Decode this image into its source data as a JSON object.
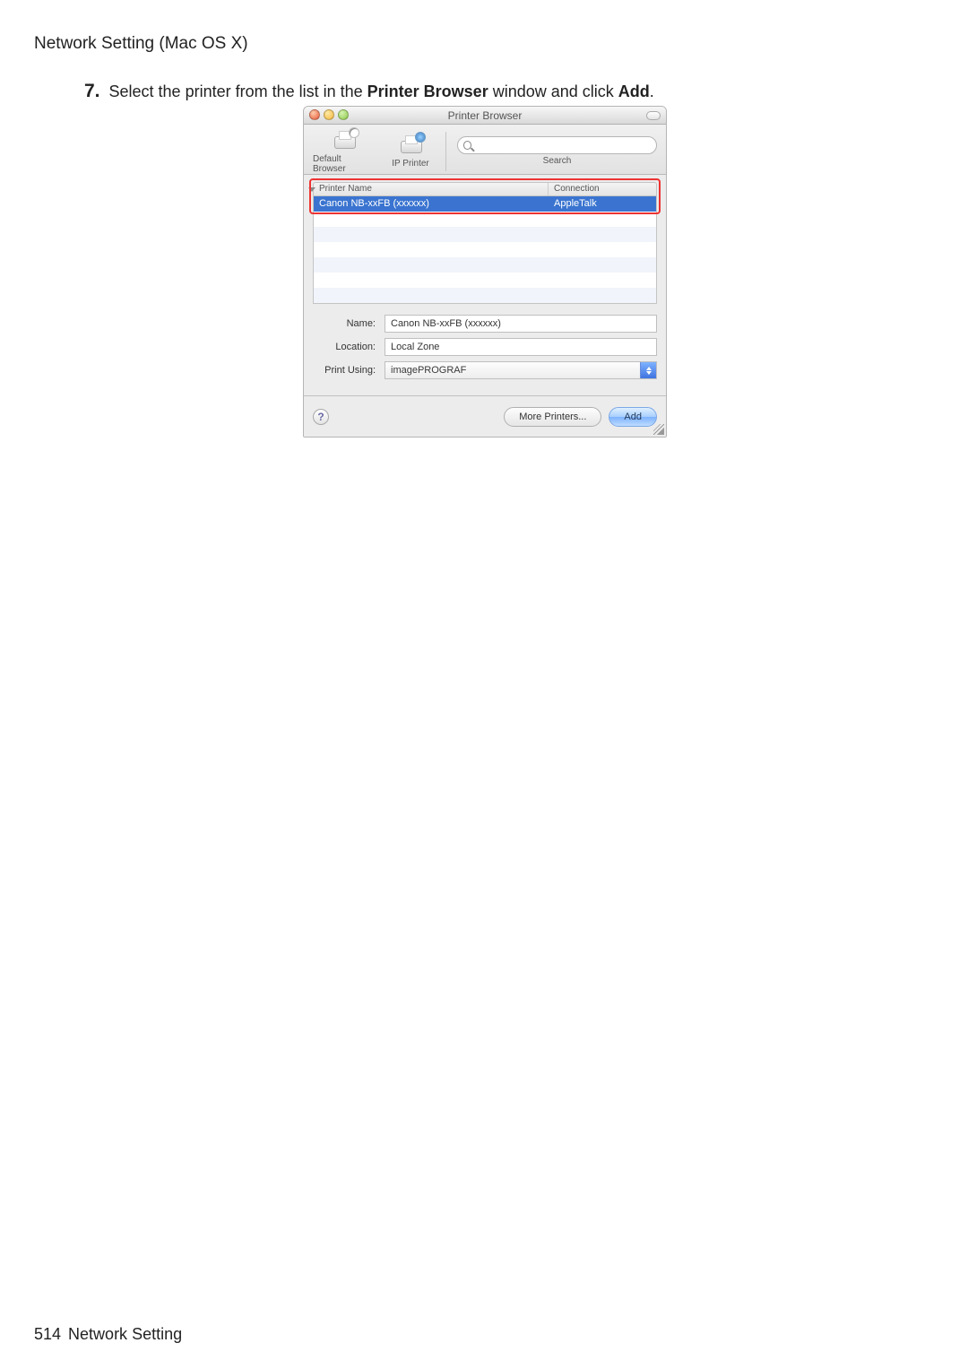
{
  "page": {
    "header": "Network Setting (Mac OS X)",
    "footer_page": "514",
    "footer_text": "Network Setting"
  },
  "instruction": {
    "step_number": "7.",
    "pre": "Select the printer from the list in the ",
    "bold1": "Printer Browser",
    "mid": " window and click ",
    "bold2": "Add",
    "post": "."
  },
  "dialog": {
    "title": "Printer Browser",
    "toolbar": {
      "default_browser": "Default Browser",
      "ip_printer": "IP Printer",
      "search_label": "Search",
      "search_value": ""
    },
    "list": {
      "col_name": "Printer Name",
      "col_conn": "Connection",
      "rows": [
        {
          "name": "Canon NB-xxFB (xxxxxx)",
          "conn": "AppleTalk",
          "selected": true
        }
      ]
    },
    "details": {
      "name_label": "Name:",
      "name_value": "Canon NB-xxFB (xxxxxx)",
      "location_label": "Location:",
      "location_value": "Local Zone",
      "print_using_label": "Print Using:",
      "print_using_value": "imagePROGRAF"
    },
    "footer": {
      "help": "?",
      "more_printers": "More Printers...",
      "add": "Add"
    }
  }
}
